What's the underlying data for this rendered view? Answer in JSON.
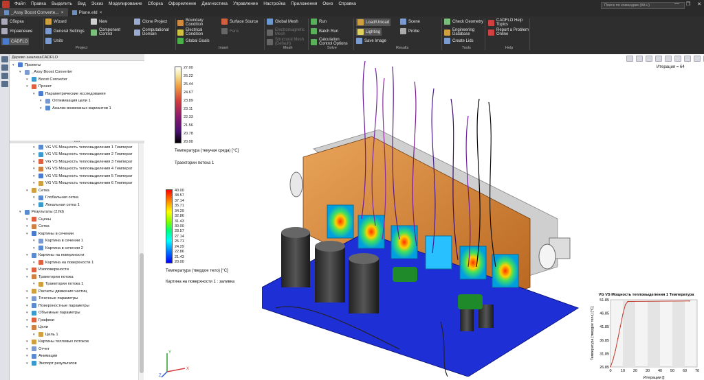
{
  "menu": [
    "Файл",
    "Правка",
    "Выделить",
    "Вид",
    "Эскиз",
    "Моделирование",
    "Сборка",
    "Оформление",
    "Диагностика",
    "Управление",
    "Настройка",
    "Приложения",
    "Окно",
    "Справка"
  ],
  "tabs": [
    {
      "label": "_Assy Boost Converte..."
    },
    {
      "label": "Plane.eld"
    }
  ],
  "search": {
    "placeholder": "Поиск по командам (Alt+/)"
  },
  "ribbon": {
    "left_tabs": [
      "Сборка",
      "Управление",
      "CADFLO"
    ],
    "project": [
      "Wizard",
      "General Settings",
      "Units",
      "New",
      "Component Control",
      "Clone Project",
      "Computational Domain"
    ],
    "insert": [
      "Boundary Condition",
      "Electrical Condition",
      "Global Goals",
      "Surface Source",
      "Fans"
    ],
    "mesh": [
      "Global Mesh",
      "Electromagnetic Mesh",
      "Structural Mesh (Default)"
    ],
    "solve": [
      "Run",
      "Batch Run",
      "Calculation Control Options"
    ],
    "results": [
      "Load/Unload",
      "Lighting",
      "Save Image",
      "Scene",
      "Probe"
    ],
    "tools": [
      "Check Geometry",
      "Engineering Database",
      "Create Lids"
    ],
    "help": [
      "CADFLO Help Topics",
      "Report a Problem Online"
    ],
    "groups": [
      "Project",
      "Insert",
      "Mesh",
      "Solve",
      "Results",
      "Tools",
      "Help"
    ]
  },
  "panel": {
    "title": "Дерево анализаCADFLO"
  },
  "tree_top": [
    {
      "label": "Проекты",
      "indent": 0
    },
    {
      "label": "_Assy Boost Converter",
      "indent": 1
    },
    {
      "label": "Boost Converter",
      "indent": 2
    },
    {
      "label": "Проект",
      "indent": 2
    },
    {
      "label": "Параметрические исследования",
      "indent": 3
    },
    {
      "label": "Оптимизация цели 1",
      "indent": 4
    },
    {
      "label": "Анализ возможных вариантов 1",
      "indent": 4
    }
  ],
  "tree_bottom": [
    {
      "label": "VG VS Мощность тепловыделения 1 Температ",
      "indent": 3
    },
    {
      "label": "VG VS Мощность тепловыделения 2 Температ",
      "indent": 3
    },
    {
      "label": "VG VS Мощность тепловыделения 3 Температ",
      "indent": 3
    },
    {
      "label": "VG VS Мощность тепловыделения 4 Температ",
      "indent": 3
    },
    {
      "label": "VG VS Мощность тепловыделения 5 Температ",
      "indent": 3
    },
    {
      "label": "VG VS Мощность тепловыделения 6 Температ",
      "indent": 3
    },
    {
      "label": "Сетка",
      "indent": 2
    },
    {
      "label": "Глобальная сетка",
      "indent": 3
    },
    {
      "label": "Локальная сетка 1",
      "indent": 3
    },
    {
      "label": "Результаты (2.fld)",
      "indent": 1
    },
    {
      "label": "Сцены",
      "indent": 2
    },
    {
      "label": "Сетка",
      "indent": 2
    },
    {
      "label": "Картины в сечении",
      "indent": 2
    },
    {
      "label": "Картина в сечении 1",
      "indent": 3
    },
    {
      "label": "Картина в сечении 2",
      "indent": 3
    },
    {
      "label": "Картины на поверхности",
      "indent": 2
    },
    {
      "label": "Картина на поверхности 1",
      "indent": 3
    },
    {
      "label": "Изоповерхности",
      "indent": 2
    },
    {
      "label": "Траектории потока",
      "indent": 2
    },
    {
      "label": "Траектории потока 1",
      "indent": 3
    },
    {
      "label": "Расчеты движения частиц",
      "indent": 2
    },
    {
      "label": "Точечные параметры",
      "indent": 2
    },
    {
      "label": "Поверхностные параметры",
      "indent": 2
    },
    {
      "label": "Объемные параметры",
      "indent": 2
    },
    {
      "label": "Графики",
      "indent": 2
    },
    {
      "label": "Цели",
      "indent": 2
    },
    {
      "label": "Цель 1",
      "indent": 3
    },
    {
      "label": "Картины тепловых потоков",
      "indent": 2
    },
    {
      "label": "Отчет",
      "indent": 2
    },
    {
      "label": "Анимации",
      "indent": 2
    },
    {
      "label": "Экспорт результатов",
      "indent": 2
    }
  ],
  "viewport": {
    "iteration": "Итерация = 64",
    "legend_fluid": {
      "values": [
        "27.00",
        "26.22",
        "25.44",
        "24.67",
        "23.89",
        "23.11",
        "22.33",
        "21.56",
        "20.78",
        "20.00"
      ],
      "title": "Температура (текучая среда) [°C]",
      "subtitle": "Траектории потока 1"
    },
    "legend_solid": {
      "values": [
        "40.00",
        "38.57",
        "37.14",
        "35.71",
        "34.29",
        "32.86",
        "31.43",
        "30.00",
        "28.57",
        "27.14",
        "25.71",
        "24.29",
        "22.86",
        "21.43",
        "20.00"
      ],
      "title": "Температура (твердое тело) [°C]",
      "subtitle": "Картина на поверхности 1 : заливка"
    },
    "axes": [
      "Y",
      "X",
      "Z"
    ]
  },
  "chart_data": {
    "type": "line",
    "title": "VG VS Мощность тепловыделения 1 Температура",
    "xlabel": "Итерации []",
    "ylabel": "Температура (твердое тело) [°C]",
    "xlim": [
      0,
      70
    ],
    "ylim": [
      26.85,
      51.85
    ],
    "x_ticks": [
      "0",
      "10",
      "20",
      "30",
      "40",
      "50",
      "60",
      "70"
    ],
    "y_ticks": [
      "26.85",
      "31.85",
      "36.85",
      "41.85",
      "46.85",
      "51.85"
    ],
    "series": [
      {
        "x": [
          0,
          2,
          4,
          6,
          8,
          10,
          12,
          14,
          64
        ],
        "values": [
          26.9,
          29.5,
          33.0,
          37.5,
          42.0,
          46.5,
          50.0,
          51.2,
          51.4
        ]
      }
    ],
    "colors": {
      "line": "#c0392b"
    }
  }
}
